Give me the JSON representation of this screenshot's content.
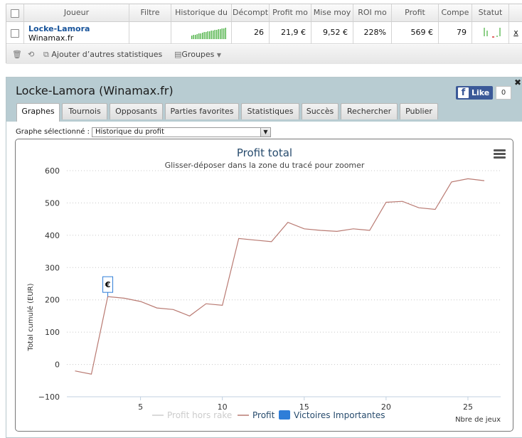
{
  "grid": {
    "headers": [
      "Joueur",
      "Filtre",
      "Historique du",
      "Décompt",
      "Profit mo",
      "Mise moy",
      "ROI mo",
      "Profit",
      "Compe",
      "Statut"
    ],
    "row": {
      "player_name": "Locke-Lamora",
      "site": "Winamax.fr",
      "filter": "",
      "decompte": "26",
      "profit_moyen": "21,9 €",
      "mise_moyenne": "9,52 €",
      "roi_moyen": "228%",
      "profit": "569 €",
      "compe": "79",
      "remove": "x"
    },
    "toolbar": {
      "add_stats": "Ajouter d’autres statistiques",
      "groups": "Groupes"
    }
  },
  "panel": {
    "title": "Locke-Lamora (Winamax.fr)",
    "fb_like": "Like",
    "fb_count": "0",
    "close": "✖",
    "tabs": [
      "Graphes",
      "Tournois",
      "Opposants",
      "Parties favorites",
      "Statistiques",
      "Succès",
      "Rechercher",
      "Publier"
    ],
    "active_tab": "Graphes",
    "graph_select_label": "Graphe sélectionné :",
    "graph_select_value": "Historique du profit"
  },
  "colors": {
    "panel_header": "#b8ccd2",
    "profit_line": "#b97a72",
    "victoires_legend": "#2f7ed8",
    "player_link": "#17539a"
  },
  "chart_data": {
    "type": "line",
    "title": "Profit total",
    "subtitle": "Glisser-déposer dans la zone du tracé pour zoomer",
    "xlabel": "Nbre de jeux",
    "ylabel": "Total cumulé (EUR)",
    "xlim": [
      0.5,
      27
    ],
    "ylim": [
      -100,
      600
    ],
    "xticks": [
      5,
      10,
      15,
      20,
      25
    ],
    "yticks": [
      -100,
      0,
      100,
      200,
      300,
      400,
      500,
      600
    ],
    "grid": "horizontal dotted",
    "legend": "bottom-center",
    "series": [
      {
        "name": "Profit",
        "color": "#b97a72",
        "x": [
          1,
          2,
          3,
          4,
          5,
          6,
          7,
          8,
          9,
          10,
          11,
          12,
          13,
          14,
          15,
          16,
          17,
          18,
          19,
          20,
          21,
          22,
          23,
          24,
          25,
          26
        ],
        "y": [
          -20,
          -30,
          210,
          205,
          195,
          175,
          170,
          150,
          188,
          183,
          390,
          385,
          380,
          440,
          420,
          415,
          412,
          420,
          415,
          502,
          505,
          485,
          480,
          565,
          575,
          569
        ]
      }
    ],
    "legend_items": [
      {
        "label": "Profit hors rake",
        "kind": "line",
        "color": "#cccccc",
        "muted": true
      },
      {
        "label": "Profit",
        "kind": "line",
        "color": "#b97a72",
        "muted": false
      },
      {
        "label": "Victoires Importantes",
        "kind": "box",
        "color": "#2f7ed8",
        "muted": false
      }
    ],
    "flag": {
      "label": "€",
      "x": 3
    }
  }
}
